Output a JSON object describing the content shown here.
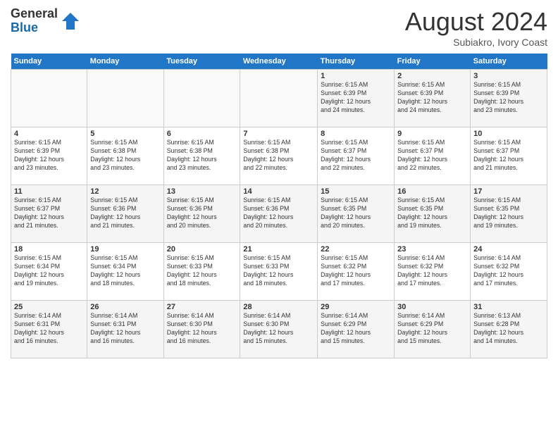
{
  "header": {
    "logo_general": "General",
    "logo_blue": "Blue",
    "month_year": "August 2024",
    "location": "Subiakro, Ivory Coast"
  },
  "weekdays": [
    "Sunday",
    "Monday",
    "Tuesday",
    "Wednesday",
    "Thursday",
    "Friday",
    "Saturday"
  ],
  "weeks": [
    [
      {
        "day": "",
        "info": ""
      },
      {
        "day": "",
        "info": ""
      },
      {
        "day": "",
        "info": ""
      },
      {
        "day": "",
        "info": ""
      },
      {
        "day": "1",
        "info": "Sunrise: 6:15 AM\nSunset: 6:39 PM\nDaylight: 12 hours\nand 24 minutes."
      },
      {
        "day": "2",
        "info": "Sunrise: 6:15 AM\nSunset: 6:39 PM\nDaylight: 12 hours\nand 24 minutes."
      },
      {
        "day": "3",
        "info": "Sunrise: 6:15 AM\nSunset: 6:39 PM\nDaylight: 12 hours\nand 23 minutes."
      }
    ],
    [
      {
        "day": "4",
        "info": "Sunrise: 6:15 AM\nSunset: 6:39 PM\nDaylight: 12 hours\nand 23 minutes."
      },
      {
        "day": "5",
        "info": "Sunrise: 6:15 AM\nSunset: 6:38 PM\nDaylight: 12 hours\nand 23 minutes."
      },
      {
        "day": "6",
        "info": "Sunrise: 6:15 AM\nSunset: 6:38 PM\nDaylight: 12 hours\nand 23 minutes."
      },
      {
        "day": "7",
        "info": "Sunrise: 6:15 AM\nSunset: 6:38 PM\nDaylight: 12 hours\nand 22 minutes."
      },
      {
        "day": "8",
        "info": "Sunrise: 6:15 AM\nSunset: 6:37 PM\nDaylight: 12 hours\nand 22 minutes."
      },
      {
        "day": "9",
        "info": "Sunrise: 6:15 AM\nSunset: 6:37 PM\nDaylight: 12 hours\nand 22 minutes."
      },
      {
        "day": "10",
        "info": "Sunrise: 6:15 AM\nSunset: 6:37 PM\nDaylight: 12 hours\nand 21 minutes."
      }
    ],
    [
      {
        "day": "11",
        "info": "Sunrise: 6:15 AM\nSunset: 6:37 PM\nDaylight: 12 hours\nand 21 minutes."
      },
      {
        "day": "12",
        "info": "Sunrise: 6:15 AM\nSunset: 6:36 PM\nDaylight: 12 hours\nand 21 minutes."
      },
      {
        "day": "13",
        "info": "Sunrise: 6:15 AM\nSunset: 6:36 PM\nDaylight: 12 hours\nand 20 minutes."
      },
      {
        "day": "14",
        "info": "Sunrise: 6:15 AM\nSunset: 6:36 PM\nDaylight: 12 hours\nand 20 minutes."
      },
      {
        "day": "15",
        "info": "Sunrise: 6:15 AM\nSunset: 6:35 PM\nDaylight: 12 hours\nand 20 minutes."
      },
      {
        "day": "16",
        "info": "Sunrise: 6:15 AM\nSunset: 6:35 PM\nDaylight: 12 hours\nand 19 minutes."
      },
      {
        "day": "17",
        "info": "Sunrise: 6:15 AM\nSunset: 6:35 PM\nDaylight: 12 hours\nand 19 minutes."
      }
    ],
    [
      {
        "day": "18",
        "info": "Sunrise: 6:15 AM\nSunset: 6:34 PM\nDaylight: 12 hours\nand 19 minutes."
      },
      {
        "day": "19",
        "info": "Sunrise: 6:15 AM\nSunset: 6:34 PM\nDaylight: 12 hours\nand 18 minutes."
      },
      {
        "day": "20",
        "info": "Sunrise: 6:15 AM\nSunset: 6:33 PM\nDaylight: 12 hours\nand 18 minutes."
      },
      {
        "day": "21",
        "info": "Sunrise: 6:15 AM\nSunset: 6:33 PM\nDaylight: 12 hours\nand 18 minutes."
      },
      {
        "day": "22",
        "info": "Sunrise: 6:15 AM\nSunset: 6:32 PM\nDaylight: 12 hours\nand 17 minutes."
      },
      {
        "day": "23",
        "info": "Sunrise: 6:14 AM\nSunset: 6:32 PM\nDaylight: 12 hours\nand 17 minutes."
      },
      {
        "day": "24",
        "info": "Sunrise: 6:14 AM\nSunset: 6:32 PM\nDaylight: 12 hours\nand 17 minutes."
      }
    ],
    [
      {
        "day": "25",
        "info": "Sunrise: 6:14 AM\nSunset: 6:31 PM\nDaylight: 12 hours\nand 16 minutes."
      },
      {
        "day": "26",
        "info": "Sunrise: 6:14 AM\nSunset: 6:31 PM\nDaylight: 12 hours\nand 16 minutes."
      },
      {
        "day": "27",
        "info": "Sunrise: 6:14 AM\nSunset: 6:30 PM\nDaylight: 12 hours\nand 16 minutes."
      },
      {
        "day": "28",
        "info": "Sunrise: 6:14 AM\nSunset: 6:30 PM\nDaylight: 12 hours\nand 15 minutes."
      },
      {
        "day": "29",
        "info": "Sunrise: 6:14 AM\nSunset: 6:29 PM\nDaylight: 12 hours\nand 15 minutes."
      },
      {
        "day": "30",
        "info": "Sunrise: 6:14 AM\nSunset: 6:29 PM\nDaylight: 12 hours\nand 15 minutes."
      },
      {
        "day": "31",
        "info": "Sunrise: 6:13 AM\nSunset: 6:28 PM\nDaylight: 12 hours\nand 14 minutes."
      }
    ]
  ]
}
